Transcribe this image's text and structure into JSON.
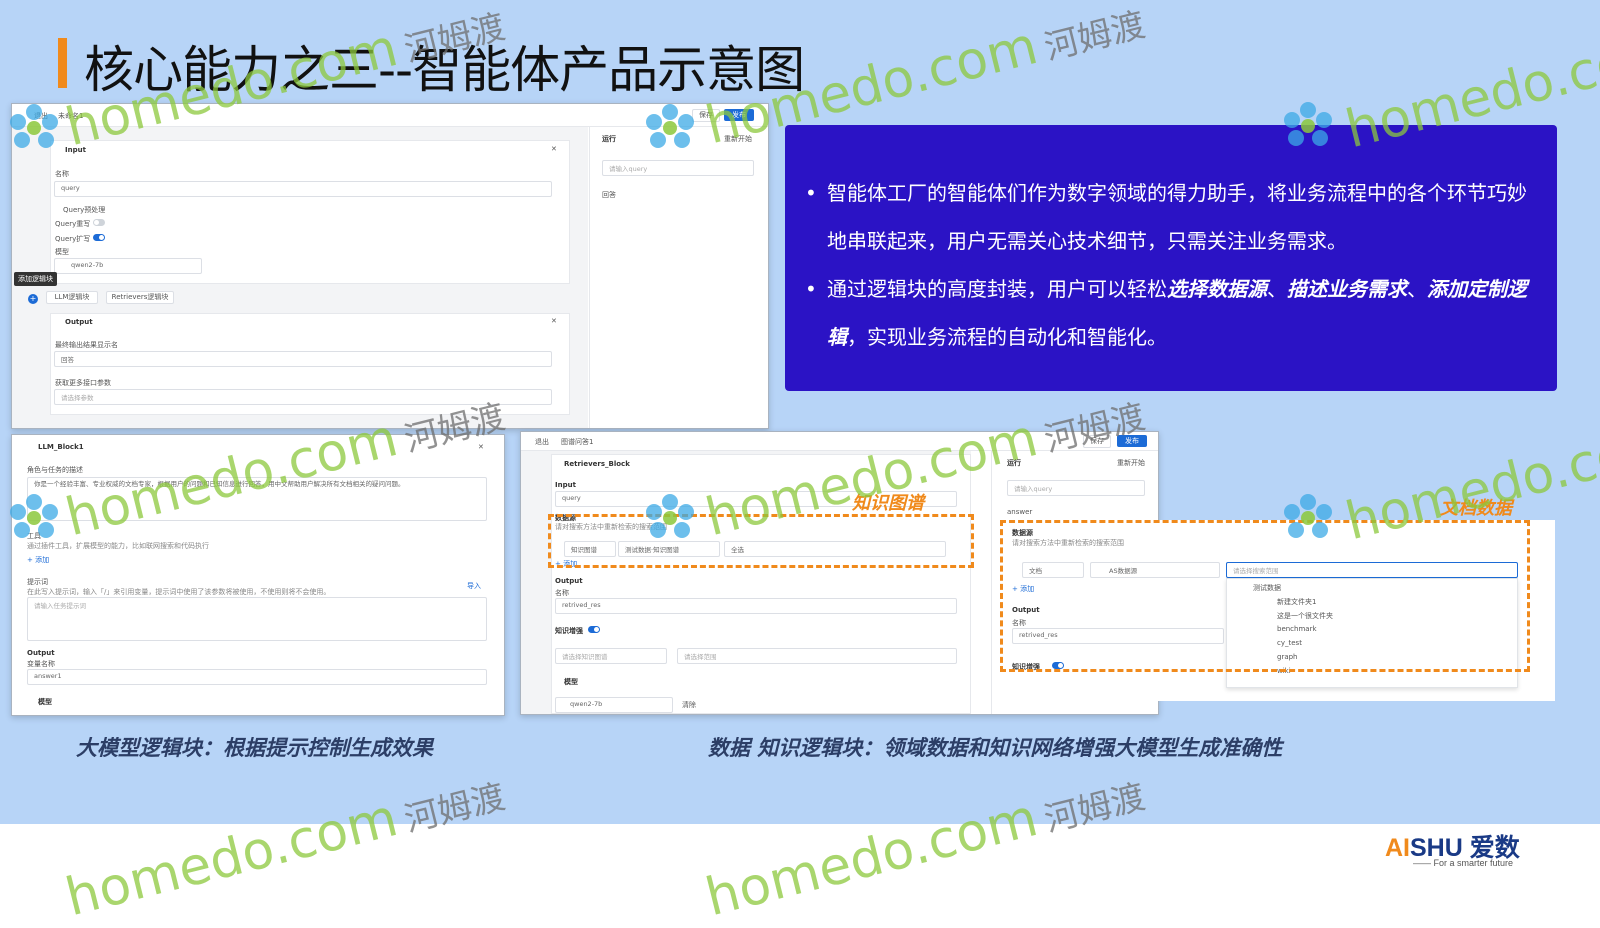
{
  "slide": {
    "title": "核心能力之三--智能体产品示意图"
  },
  "bullets": [
    {
      "text_plain": "智能体工厂的智能体们作为数字领域的得力助手，将业务流程中的各个环节巧妙",
      "text_line2": "地串联起来，用户无需关心技术细节，只需关注业务需求。"
    },
    {
      "prefix": "通过逻辑块的高度封装，用户可以轻松",
      "em1": "选择数据源",
      "sep1": "、",
      "em2": "描述业务需求",
      "sep2": "、",
      "em3": "添加定制逻",
      "em3b": "辑",
      "suffix": "，实现业务流程的自动化和智能化。"
    }
  ],
  "captions": {
    "left": "大模型逻辑块：根据提示控制生成效果",
    "right": "数据 知识逻辑块：领域数据和知识网络增强大模型生成准确性"
  },
  "annotations": {
    "knowledge_graph": "知识图谱",
    "doc_data": "文档数据"
  },
  "shot1": {
    "back": "退出",
    "breadcrumb": "未命名1",
    "save": "保存",
    "publish": "发布",
    "input_block": "Input",
    "name_label": "名称",
    "name_value": "query",
    "query_pre": "Query预处理",
    "query_rewrite": "Query重写",
    "query_expand": "Query扩写",
    "model_label": "模型",
    "model_value": "qwen2-7b",
    "add_logic": "添加逻辑块",
    "llm_block": "LLM逻辑块",
    "retriever_block": "Retrievers逻辑块",
    "output_block": "Output",
    "output_label": "最终输出结果显示名",
    "output_value": "回答",
    "more_label": "获取更多接口参数",
    "more_placeholder": "请选择参数",
    "run_title": "运行",
    "restart": "重新开始",
    "query_placeholder": "请输入query",
    "answer_label": "回答"
  },
  "shot2": {
    "block_title": "LLM_Block1",
    "role_label": "角色与任务的描述",
    "role_text": "你是一个经验丰富、专业权威的文档专家，根据用户的问题和已知信息进行回答，用中文帮助用户解决所有文档相关的疑问问题。",
    "tools_label": "工具",
    "tools_desc": "通过插件工具，扩展模型的能力，比如联网搜索和代码执行",
    "add": "+ 添加",
    "prompt_label": "提示词",
    "prompt_desc": "在此写入提示词，输入「/」来引用变量，提示词中使用了该参数将被使用，不使用则将不会使用。",
    "import": "导入",
    "prompt_placeholder": "请输入任务提示词",
    "output_label": "Output",
    "output_sub": "变量名称",
    "output_value": "answer1",
    "model_label": "模型"
  },
  "shot3": {
    "back": "退出",
    "breadcrumb": "图谱问答1",
    "save": "保存",
    "publish": "发布",
    "block_title": "Retrievers_Block",
    "input_label": "Input",
    "input_value": "query",
    "datasource_label": "数据源",
    "datasource_desc": "请对搜索方法中重新检索的搜索范围",
    "type_value": "知识图谱",
    "graph_value": "测试数据·知识图谱",
    "scope_value": "全选",
    "add": "+ 添加",
    "output_label": "Output",
    "output_name": "名称",
    "output_value": "retrived_res",
    "enhance_label": "知识增强",
    "enhance_sel1": "请选择知识图谱",
    "enhance_sel2": "请选择范围",
    "model_label": "模型",
    "model_value": "qwen2-7b",
    "clear": "清除",
    "run_title": "运行",
    "restart": "重新开始",
    "query_placeholder": "请输入query",
    "answer": "answer"
  },
  "shot4": {
    "datasource_label": "数据源",
    "datasource_desc": "请对搜索方法中重新检索的搜索范围",
    "type_value": "文档",
    "as_value": "AS数据源",
    "scope_placeholder": "请选择搜索范围",
    "add": "+ 添加",
    "output_label": "Output",
    "output_name": "名称",
    "output_value": "retrived_res",
    "enhance_label": "知识增强",
    "tree": [
      "测试数据",
      "新建文件夹1",
      "这是一个很文件夹",
      "benchmark",
      "cy_test",
      "graph",
      "wiki"
    ]
  },
  "watermark": {
    "brand": "homedo.com",
    "cn": "河姆渡"
  },
  "logo": {
    "ai": "AI",
    "rest": "SHU 爱数",
    "tagline": "—— For a smarter future"
  },
  "colors": {
    "slide_bg": "#b7d4f7",
    "title_bar": "#f08a1c",
    "textbox_bg": "#2b13c5",
    "caption": "#2c3e66",
    "highlight": "#f08a1c",
    "ui_blue": "#1c6bd6"
  }
}
